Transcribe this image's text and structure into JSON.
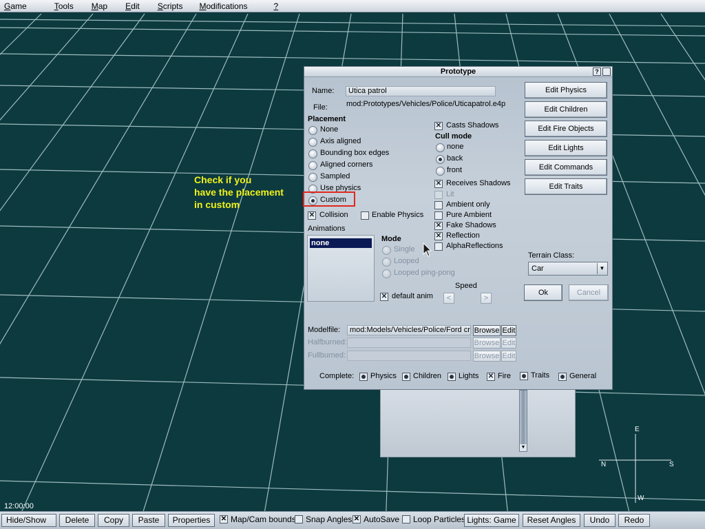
{
  "menu": [
    {
      "label": "Game",
      "u": "G",
      "rest": "ame"
    },
    {
      "label": "Tools",
      "u": "T",
      "rest": "ools"
    },
    {
      "label": "Map",
      "u": "M",
      "rest": "ap"
    },
    {
      "label": "Edit",
      "u": "E",
      "rest": "dit"
    },
    {
      "label": "Scripts",
      "u": "S",
      "rest": "cripts"
    },
    {
      "label": "Modifications",
      "u": "M",
      "rest": "odifications"
    },
    {
      "label": "?",
      "u": "?",
      "rest": ""
    }
  ],
  "annotation": {
    "text": "Check if you\nhave the placement\nin custom",
    "color": "#f2f21a",
    "box_color": "#e0271e"
  },
  "dialog": {
    "title": "Prototype",
    "help_btn": "?",
    "name_label": "Name:",
    "name_value": "Utica patrol",
    "file_label": "File:",
    "file_value": "mod:Prototypes/Vehicles/Police/Uticapatrol.e4p",
    "placement_label": "Placement",
    "placement_options": [
      {
        "label": "None",
        "selected": false
      },
      {
        "label": "Axis aligned",
        "selected": false
      },
      {
        "label": "Bounding box edges",
        "selected": false
      },
      {
        "label": "Aligned corners",
        "selected": false
      },
      {
        "label": "Sampled",
        "selected": false
      },
      {
        "label": "Use physics",
        "selected": false
      },
      {
        "label": "Custom",
        "selected": true
      }
    ],
    "collision_label": "Collision",
    "collision_checked": true,
    "enable_physics_label": "Enable Physics",
    "enable_physics_checked": false,
    "casts_shadows_label": "Casts Shadows",
    "cull_mode_label": "Cull mode",
    "cull_options": [
      {
        "label": "none",
        "selected": false
      },
      {
        "label": "back",
        "selected": true
      },
      {
        "label": "front",
        "selected": false
      }
    ],
    "receives_shadows_label": "Receives Shadows",
    "lit_label": "Lit",
    "ambient_only_label": "Ambient only",
    "pure_ambient_label": "Pure Ambient",
    "fake_shadows_label": "Fake Shadows",
    "reflection_label": "Reflection",
    "alpha_reflections_label": "AlphaReflections",
    "animations_label": "Animations",
    "animation_selected": "none",
    "mode_label": "Mode",
    "mode_options": [
      "Single",
      "Looped",
      "Looped ping-pong"
    ],
    "speed_label": "Speed",
    "default_anim_label": "default anim",
    "buttons": [
      "Edit Physics",
      "Edit Children",
      "Edit Fire Objects",
      "Edit Lights",
      "Edit Commands",
      "Edit Traits"
    ],
    "terrain_class_label": "Terrain Class:",
    "terrain_class_value": "Car",
    "ok_label": "Ok",
    "cancel_label": "Cancel",
    "modelfile_label": "Modelfile:",
    "modelfile_value": "mod:Models/Vehicles/Police/Ford cro",
    "halfburned_label": "Halfburned:",
    "fullburned_label": "Fullburned:",
    "browse_label": "Browse",
    "edit_label": "Edit",
    "complete_label": "Complete:",
    "complete_items": [
      {
        "label": "Physics",
        "state": "dot"
      },
      {
        "label": "Children",
        "state": "dot"
      },
      {
        "label": "Lights",
        "state": "dot"
      },
      {
        "label": "Fire",
        "state": "x"
      },
      {
        "label": "Traits",
        "state": "dot"
      },
      {
        "label": "General",
        "state": "dot"
      }
    ]
  },
  "status": {
    "time": "12:00:00"
  },
  "toolbar": {
    "hide_show": "Hide/Show",
    "delete": "Delete",
    "copy": "Copy",
    "paste": "Paste",
    "properties": "Properties",
    "map_cam_bounds": "Map/Cam bounds",
    "snap_angles": "Snap Angles",
    "autosave": "AutoSave",
    "loop_particles": "Loop Particles",
    "lights_game": "Lights: Game",
    "reset_angles": "Reset Angles",
    "undo": "Undo",
    "redo": "Redo"
  },
  "compass": {
    "e": "E",
    "n": "N",
    "s": "S",
    "w": "W"
  }
}
